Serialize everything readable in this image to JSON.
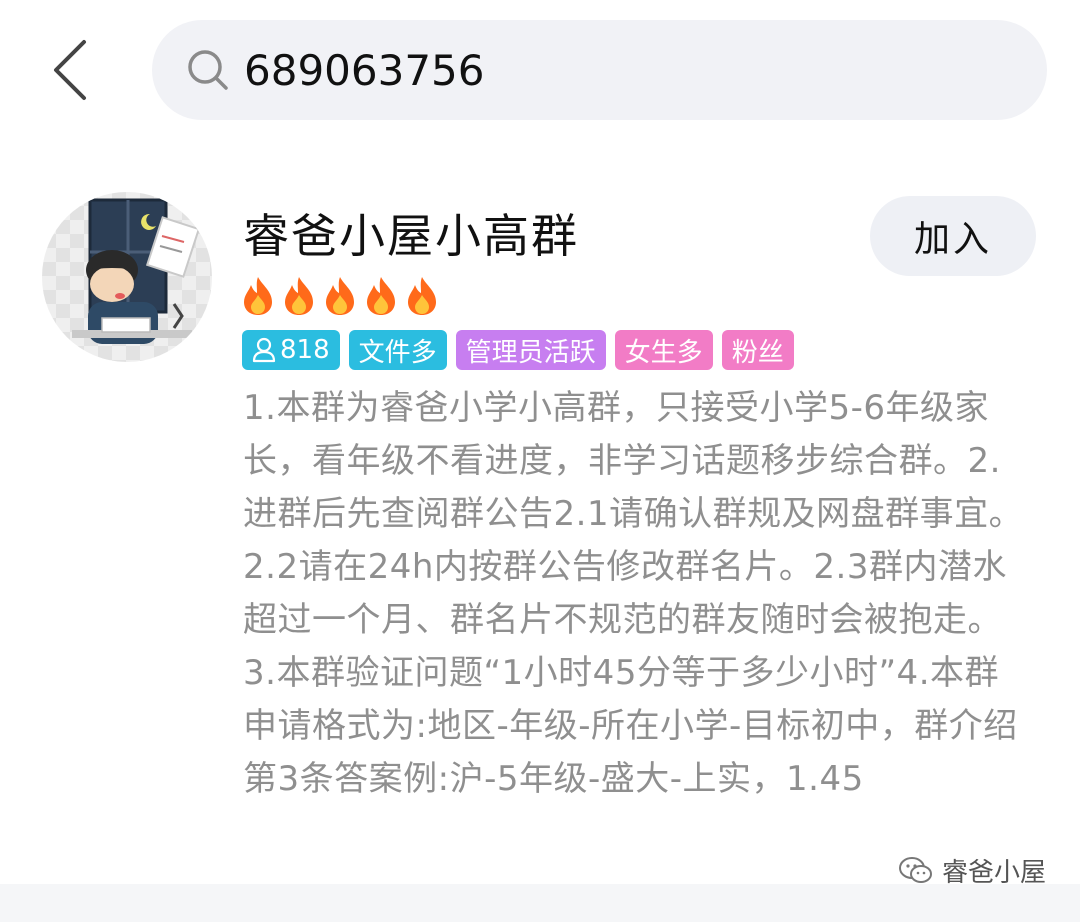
{
  "search": {
    "query": "689063756"
  },
  "result": {
    "group_name": "睿爸小屋小高群",
    "join_label": "加入",
    "flame_count": 5,
    "tags": [
      {
        "text": "818",
        "icon": "person-icon",
        "color": "#2bbde0"
      },
      {
        "text": "文件多",
        "color": "#2bbde0"
      },
      {
        "text": "管理员活跃",
        "color": "#c77ef0"
      },
      {
        "text": "女生多",
        "color": "#f27cc6"
      },
      {
        "text": "粉丝",
        "color": "#f27cc6"
      }
    ],
    "description": "1.本群为睿爸小学小高群，只接受小学5-6年级家长，看年级不看进度，非学习话题移步综合群。2.进群后先查阅群公告2.1请确认群规及网盘群事宜。2.2请在24h内按群公告修改群名片。2.3群内潜水超过一个月、群名片不规范的群友随时会被抱走。3.本群验证问题“1小时45分等于多少小时”4.本群申请格式为:地区-年级-所在小学-目标初中，群介绍第3条答案例:沪-5年级-盛大-上实，1.45"
  },
  "watermark": {
    "text": "睿爸小屋",
    "icon": "wechat-icon"
  }
}
